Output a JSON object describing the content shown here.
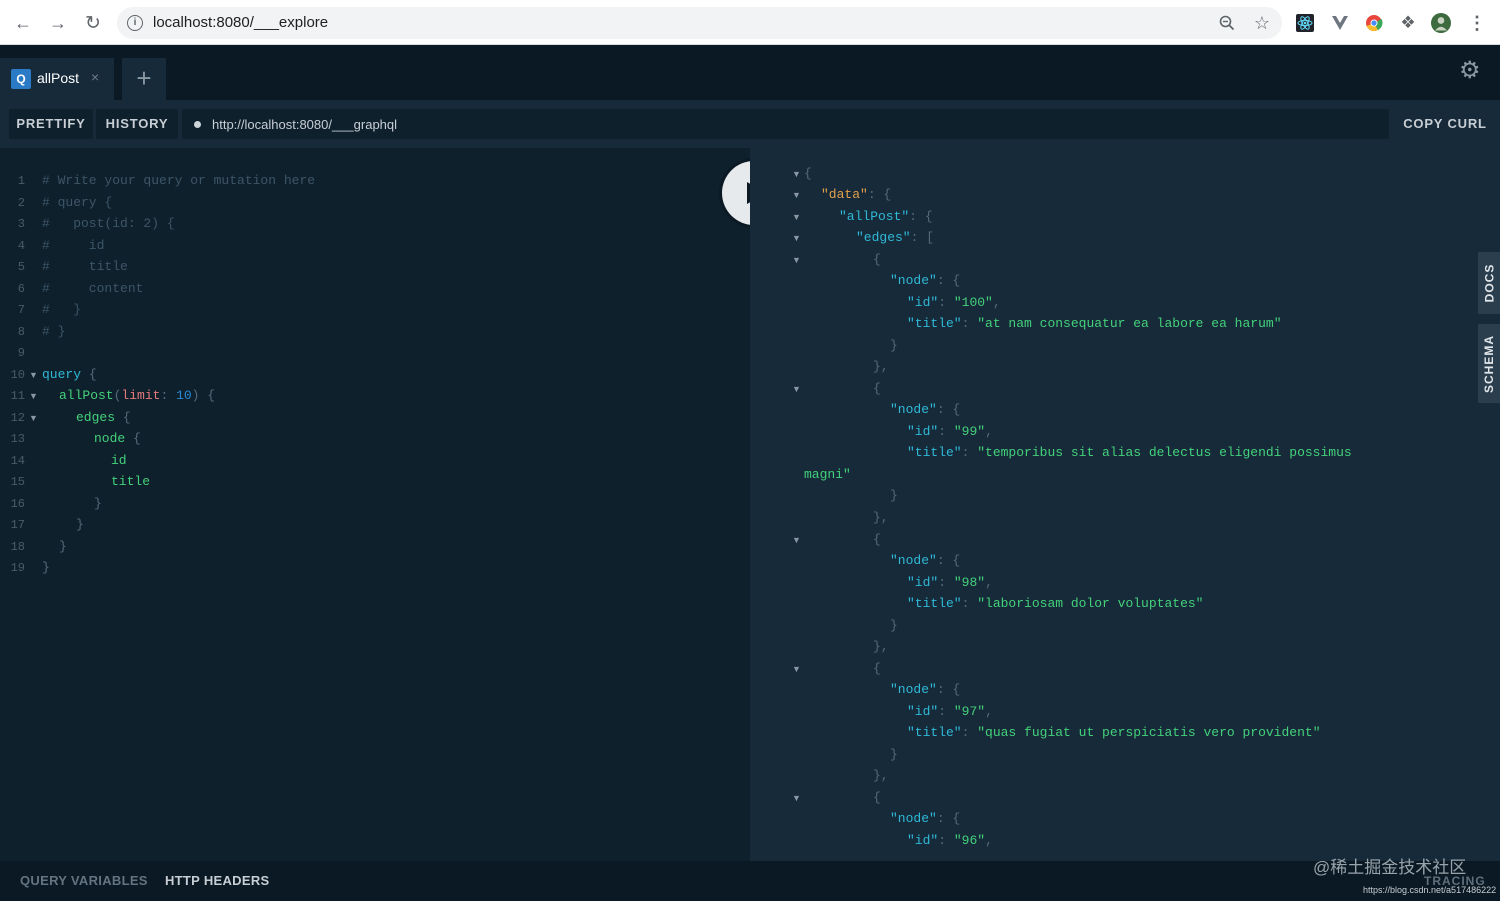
{
  "browser": {
    "url": "localhost:8080/___explore",
    "back_icon": "arrow-left-icon",
    "forward_icon": "arrow-right-icon",
    "reload_icon": "reload-icon",
    "zoom_icon": "zoom-icon",
    "star_icon": "star-icon"
  },
  "tabs": [
    {
      "badge": "Q",
      "label": "allPost",
      "close": "×"
    }
  ],
  "add_tab": "+",
  "toolbar": {
    "prettify": "PRETTIFY",
    "history": "HISTORY",
    "endpoint": "http://localhost:8080/___graphql",
    "copy_curl": "COPY CURL"
  },
  "editor_lines": [
    {
      "n": "1",
      "text": "# Write your query or mutation here"
    },
    {
      "n": "2",
      "text": "# query {"
    },
    {
      "n": "3",
      "text": "#   post(id: 2) {"
    },
    {
      "n": "4",
      "text": "#     id"
    },
    {
      "n": "5",
      "text": "#     title"
    },
    {
      "n": "6",
      "text": "#     content"
    },
    {
      "n": "7",
      "text": "#   }"
    },
    {
      "n": "8",
      "text": "# }"
    },
    {
      "n": "9",
      "text": ""
    },
    {
      "n": "10",
      "text": "query {"
    },
    {
      "n": "11",
      "text": "allPost(limit: 10) {"
    },
    {
      "n": "12",
      "text": "edges {"
    },
    {
      "n": "13",
      "text": "node {"
    },
    {
      "n": "14",
      "text": "id"
    },
    {
      "n": "15",
      "text": "title"
    },
    {
      "n": "16",
      "text": "}"
    },
    {
      "n": "17",
      "text": "}"
    },
    {
      "n": "18",
      "text": "}"
    },
    {
      "n": "19",
      "text": "}"
    }
  ],
  "results": {
    "posts": [
      {
        "id": "100",
        "title": "at nam consequatur ea labore ea harum"
      },
      {
        "id": "99",
        "title": "temporibus sit alias delectus eligendi possimus",
        "title_cont": "magni\""
      },
      {
        "id": "98",
        "title": "laboriosam dolor voluptates"
      },
      {
        "id": "97",
        "title": "quas fugiat ut perspiciatis vero provident"
      },
      {
        "id": "96"
      }
    ]
  },
  "side_tabs": {
    "docs": "DOCS",
    "schema": "SCHEMA"
  },
  "bottom": {
    "query_variables": "QUERY VARIABLES",
    "http_headers": "HTTP HEADERS",
    "tracing": "TRACING",
    "watermark": "@稀土掘金技术社区",
    "watermark_url": "https://blog.csdn.net/a517486222"
  }
}
